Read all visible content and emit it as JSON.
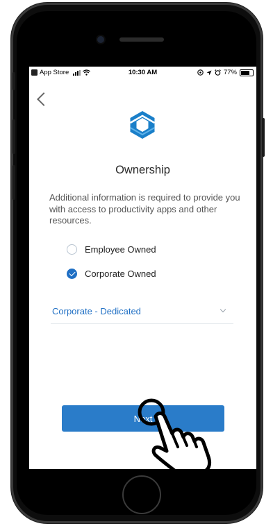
{
  "status_bar": {
    "back_app": "App Store",
    "time": "10:30 AM",
    "battery_text": "77%",
    "battery_level": 0.77,
    "icons": [
      "signal-icon",
      "wifi-icon",
      "at-icon",
      "location-icon",
      "alarm-icon",
      "battery-icon"
    ]
  },
  "nav": {
    "back_icon": "chevron-left-icon"
  },
  "header": {
    "logo_icon": "hexagon-logo-icon",
    "title": "Ownership"
  },
  "description": "Additional information is required to provide you with access to productivity apps and other resources.",
  "ownership_options": [
    {
      "label": "Employee Owned",
      "selected": false
    },
    {
      "label": "Corporate Owned",
      "selected": true
    }
  ],
  "device_type_select": {
    "value": "Corporate - Dedicated",
    "icon": "chevron-down-icon"
  },
  "next_button": {
    "label": "Next"
  },
  "overlay": {
    "icon": "pointing-hand-icon"
  },
  "colors": {
    "accent": "#1f6fc4",
    "button": "#2a7cc9",
    "logo": "#1a7fc9"
  }
}
